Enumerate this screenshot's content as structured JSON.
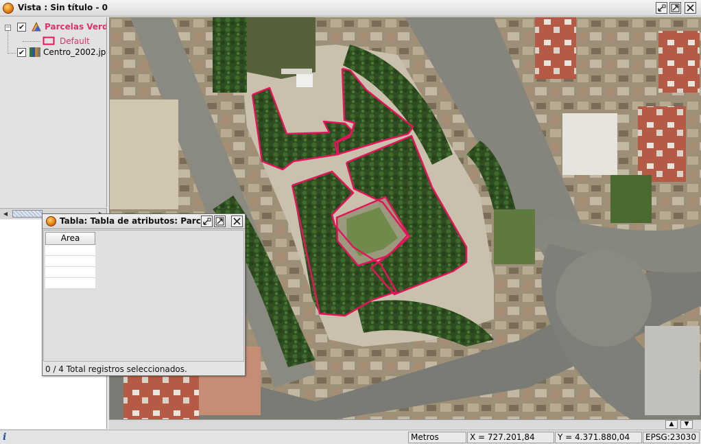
{
  "window": {
    "title": "Vista : Sin título - 0"
  },
  "toc": {
    "layers": [
      {
        "name": "Parcelas Verde",
        "checked": true,
        "color": "#e0306a",
        "legend": "Default"
      },
      {
        "name": "Centro_2002.jp",
        "checked": true
      }
    ],
    "check_mark": "✔",
    "collapse_glyph": "−"
  },
  "attribute_table": {
    "title": "Tabla: Tabla de atributos: Parc...",
    "columns": [
      "Area"
    ],
    "status": "0 / 4 Total registros seleccionados."
  },
  "status_bar": {
    "info_icon": "i",
    "units": "Metros",
    "x": "X = 727.201,84",
    "y": "Y = 4.371.880,04",
    "epsg": "EPSG:23030"
  },
  "map": {
    "polygon_color": "#e3145a"
  },
  "colors": {
    "selected_layer_text": "#e0306a"
  }
}
